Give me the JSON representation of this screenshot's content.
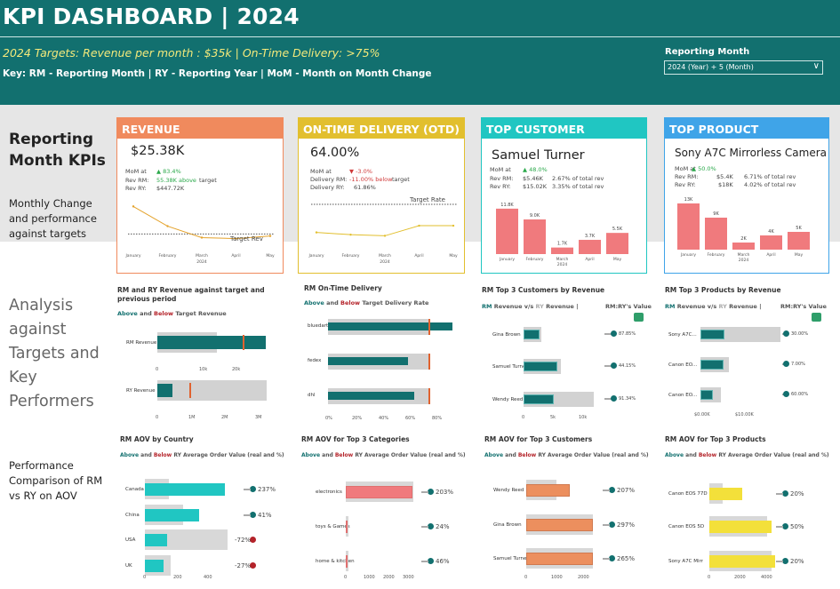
{
  "header": {
    "title": "KPI DASHBOARD | 2024",
    "targets": "2024 Targets: Revenue per month : $35k | On-Time Delivery: >75%",
    "key": "Key: RM - Reporting Month | RY - Reporting Year | MoM - Month on Month Change",
    "reporting_month_label": "Reporting Month",
    "reporting_month_value": "2024 (Year) + 5 (Month)",
    "colors": {
      "header_bg": "#12706f",
      "targets_text": "#f3e97b"
    }
  },
  "sections": {
    "kpis": "Reporting Month KPIs",
    "kpis_sub": "Monthly Change and performance against targets",
    "analysis": "Analysis against Targets and Key Performers",
    "aov": "Performance Comparison of RM vs RY on AOV"
  },
  "months": [
    "January",
    "February",
    "March",
    "April",
    "May"
  ],
  "year_label": "2024",
  "cards": {
    "revenue": {
      "title": "REVENUE",
      "color": "#f08a5d",
      "value": "$25.38K",
      "mom_label": "MoM at",
      "mom": "▲ 83.4%",
      "rev_rm_label": "Rev RM:",
      "rev_rm": "55.38K",
      "rev_rm_note": "above",
      "rev_rm_suffix": "target",
      "rev_ry_label": "Rev RY:",
      "rev_ry": "$447.72K",
      "target_label": "Target Rev",
      "line_points": [
        29,
        23,
        19.5,
        19.2,
        20
      ],
      "target": 20.6,
      "ylim": [
        18,
        31
      ]
    },
    "otd": {
      "title": "ON-TIME DELIVERY (OTD)",
      "color": "#e2bf2e",
      "value": "64.00%",
      "mom_label": "MoM at",
      "mom": "▼ -3.0%",
      "delivery_rm_label": "Delivery RM:",
      "delivery_rm": "-11.00% below",
      "delivery_rm_suffix": "target",
      "delivery_ry_label": "Delivery RY:",
      "delivery_ry": "61.86%",
      "target_label": "Target Rate",
      "line_points": [
        62.5,
        61.5,
        61.0,
        65.5,
        65.5
      ],
      "target": 75,
      "ylim": [
        58,
        77
      ]
    },
    "customer": {
      "title": "TOP CUSTOMER",
      "color": "#20c6c2",
      "value": "Samuel Turner",
      "mom_label": "MoM at",
      "mom": "▲ 48.0%",
      "rev_rm_label": "Rev RM:",
      "rev_rm": "$5.46K",
      "rev_rm_note": "2.67% of total rev",
      "rev_ry_label": "Rev RY:",
      "rev_ry": "$15.02K",
      "rev_ry_note": "3.35% of total rev",
      "bar_values": [
        11.8,
        9.0,
        1.7,
        3.7,
        5.5
      ],
      "bar_labels": [
        "11.8K",
        "9.0K",
        "1.7K",
        "3.7K",
        "5.5K"
      ]
    },
    "product": {
      "title": "TOP PRODUCT",
      "color": "#3fa4e8",
      "value": "Sony A7C Mirrorless Camera",
      "mom_label": "MoM at",
      "mom": "▲ 50.0%",
      "rev_rm_label": "Rev RM:",
      "rev_rm": "$5.4K",
      "rev_rm_note": "6.71% of total rev",
      "rev_ry_label": "Rev RY:",
      "rev_ry": "$18K",
      "rev_ry_note": "4.02% of total rev",
      "bar_values": [
        13,
        9,
        2,
        4,
        5
      ],
      "bar_labels": [
        "13K",
        "9K",
        "2K",
        "4K",
        "5K"
      ]
    }
  },
  "panels": {
    "rev_target": {
      "title": "RM and RY Revenue against target and previous period",
      "legend_above": "Above",
      "legend_and": "and",
      "legend_below": "Below",
      "legend_rest": "Target Revenue",
      "rows": [
        {
          "label": "RM Revenue",
          "ticks": [
            "0",
            "10k",
            "20k"
          ]
        },
        {
          "label": "RY Revenue",
          "ticks": [
            "0",
            "1M",
            "2M",
            "3M"
          ]
        }
      ]
    },
    "otd": {
      "title": "RM On-Time Delivery",
      "legend_above": "Above",
      "legend_and": "and",
      "legend_below": "Below",
      "legend_rest": "Target Delivery Rate",
      "rows": [
        "bluedart",
        "fedex",
        "dhl"
      ],
      "ticks": [
        "0%",
        "20%",
        "40%",
        "60%",
        "80%"
      ]
    },
    "top_customers": {
      "title": "RM Top 3 Customers by Revenue",
      "legend_rm": "RM",
      "legend_mid": "Revenue v/s",
      "legend_ry": "RY",
      "legend_rest": "Revenue |",
      "ratio_label": "RM:RY's Value",
      "rows": [
        "Gina Brown",
        "Samuel Turner",
        "Wendy Reed"
      ],
      "values": [
        "87.85%",
        "44.15%",
        "91.34%"
      ],
      "ticks": [
        "0",
        "5k",
        "10k"
      ]
    },
    "top_products": {
      "title": "RM Top 3 Products by Revenue",
      "legend_rm": "RM",
      "legend_mid": "Revenue v/s",
      "legend_ry": "RY",
      "legend_rest": "Revenue |",
      "ratio_label": "RM:RY's Value",
      "rows": [
        "Sony A7C...",
        "Canon EO...",
        "Canon EO..."
      ],
      "values": [
        "30.00%",
        "7.00%",
        "60.00%"
      ],
      "ticks": [
        "$0.00K",
        "$10.00K"
      ]
    },
    "aov_country": {
      "title": "RM AOV by Country",
      "legend_above": "Above",
      "legend_and": "and",
      "legend_below": "Below",
      "legend_rest": "RY Average Order Value (real and %)",
      "rows": [
        "Canada",
        "China",
        "USA",
        "UK"
      ],
      "values": [
        "237%",
        "41%",
        "-72%",
        "-27%"
      ],
      "ticks": [
        "0",
        "200",
        "400"
      ]
    },
    "aov_categories": {
      "title": "RM AOV for Top 3 Categories",
      "legend_above": "Above",
      "legend_and": "and",
      "legend_below": "Below",
      "legend_rest": "RY Average Order Value (real and %)",
      "rows": [
        "electronics",
        "toys & Games",
        "home & kitchen"
      ],
      "values": [
        "203%",
        "24%",
        "46%"
      ],
      "ticks": [
        "0",
        "1000",
        "2000",
        "3000"
      ]
    },
    "aov_customers": {
      "title": "RM AOV for Top 3 Customers",
      "legend_above": "Above",
      "legend_and": "and",
      "legend_below": "Below",
      "legend_rest": "RY Average Order Value (real and %)",
      "rows": [
        "Wendy Reed",
        "Gina Brown",
        "Samuel Turner"
      ],
      "values": [
        "207%",
        "297%",
        "265%"
      ],
      "ticks": [
        "0",
        "1000",
        "2000"
      ]
    },
    "aov_products": {
      "title": "RM AOV for Top 3 Products",
      "legend_above": "Above",
      "legend_and": "and",
      "legend_below": "Below",
      "legend_rest": "RY Average Order Value (real and %)",
      "rows": [
        "Canon EOS 77D",
        "Canon EOS 5D",
        "Sony A7C Mirr"
      ],
      "values": [
        "20%",
        "50%",
        "20%"
      ],
      "ticks": [
        "0",
        "2000",
        "4000"
      ]
    }
  },
  "chart_data": [
    {
      "type": "line",
      "title": "",
      "categories": [
        "January",
        "February",
        "March",
        "April",
        "May"
      ],
      "series": [
        {
          "values": [
            29,
            23,
            19.5,
            19.2,
            20
          ]
        }
      ],
      "xlabel": "2024"
    },
    {
      "type": "line",
      "title": "",
      "categories": [
        "January",
        "February",
        "March",
        "April",
        "May"
      ],
      "series": [
        {
          "values": [
            62.5,
            61.5,
            61.0,
            65.5,
            65.5
          ]
        }
      ],
      "xlabel": "2024"
    },
    {
      "type": "bar",
      "title": "",
      "categories": [
        "January",
        "February",
        "March",
        "April",
        "May"
      ],
      "values": [
        11.8,
        9.0,
        1.7,
        3.7,
        5.5
      ]
    },
    {
      "type": "bar",
      "title": "",
      "categories": [
        "January",
        "February",
        "March",
        "April",
        "May"
      ],
      "values": [
        13,
        9,
        2,
        4,
        5
      ]
    },
    {
      "type": "bar",
      "title": "RM and RY Revenue against target and previous period",
      "categories": [
        "RM Revenue",
        "RY Revenue"
      ],
      "values": [
        25380,
        447720
      ]
    },
    {
      "type": "bar",
      "title": "RM On-Time Delivery",
      "categories": [
        "bluedart",
        "fedex",
        "dhl"
      ],
      "values": [
        95,
        60,
        67
      ],
      "target": 75
    },
    {
      "type": "bar",
      "title": "RM Top 3 Customers by Revenue",
      "categories": [
        "Gina Brown",
        "Samuel Turner",
        "Wendy Reed"
      ],
      "series": [
        {
          "name": "RM",
          "values": [
            2.2,
            5.46,
            5.2
          ]
        },
        {
          "name": "RY",
          "values": [
            2.5,
            12.4,
            12.2
          ]
        }
      ]
    },
    {
      "type": "bar",
      "title": "RM Top 3 Products by Revenue",
      "categories": [
        "Sony A7C...",
        "Canon EO...",
        "Canon EO..."
      ],
      "series": [
        {
          "name": "RM",
          "values": [
            5.4,
            5.3,
            2.7
          ]
        },
        {
          "name": "RY",
          "values": [
            18,
            7.6,
            4.5
          ]
        }
      ]
    },
    {
      "type": "bar",
      "title": "RM AOV by Country",
      "categories": [
        "Canada",
        "China",
        "USA",
        "UK"
      ],
      "values": [
        330,
        230,
        100,
        90
      ]
    },
    {
      "type": "bar",
      "title": "RM AOV for Top 3 Categories",
      "categories": [
        "electronics",
        "toys & Games",
        "home & kitchen"
      ],
      "values": [
        3000,
        50,
        50
      ]
    },
    {
      "type": "bar",
      "title": "RM AOV for Top 3 Customers",
      "categories": [
        "Wendy Reed",
        "Gina Brown",
        "Samuel Turner"
      ],
      "values": [
        1100,
        1800,
        1800
      ]
    },
    {
      "type": "bar",
      "title": "RM AOV for Top 3 Products",
      "categories": [
        "Canon EOS 77D",
        "Canon EOS 5D",
        "Sony A7C Mirr"
      ],
      "values": [
        2400,
        4200,
        4500
      ]
    }
  ]
}
